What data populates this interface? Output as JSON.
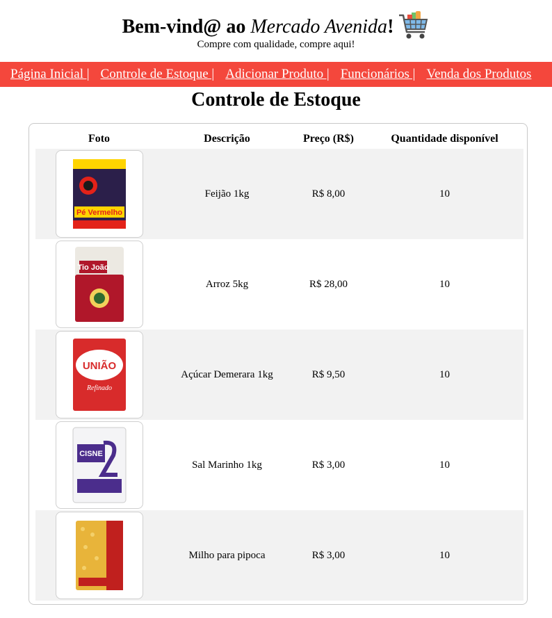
{
  "header": {
    "title_prefix": "Bem-vind@ ao ",
    "title_store": "Mercado Avenida",
    "title_suffix": "!",
    "subtitle": "Compre com qualidade, compre aqui!",
    "cart_icon": "shopping-cart-icon"
  },
  "nav": {
    "items": [
      {
        "label": "Página Inicial |"
      },
      {
        "label": "Controle de Estoque |"
      },
      {
        "label": "Adicionar Produto |"
      },
      {
        "label": "Funcionários |"
      },
      {
        "label": "Venda dos Produtos"
      }
    ],
    "background": "#f4473c"
  },
  "page_title": "Controle de Estoque",
  "table": {
    "headers": [
      "Foto",
      "Descrição",
      "Preço (R$)",
      "Quantidade disponível"
    ],
    "rows": [
      {
        "photo": "feijao-package",
        "description": "Feijão 1kg",
        "price": "R$ 8,00",
        "quantity": "10"
      },
      {
        "photo": "arroz-package",
        "description": "Arroz 5kg",
        "price": "R$ 28,00",
        "quantity": "10"
      },
      {
        "photo": "acucar-package",
        "description": "Açúcar Demerara 1kg",
        "price": "R$ 9,50",
        "quantity": "10"
      },
      {
        "photo": "sal-package",
        "description": "Sal Marinho 1kg",
        "price": "R$ 3,00",
        "quantity": "10"
      },
      {
        "photo": "milho-package",
        "description": "Milho para pipoca",
        "price": "R$ 3,00",
        "quantity": "10"
      }
    ]
  },
  "colors": {
    "nav_bg": "#f4473c",
    "row_stripe": "#f2f2f2"
  }
}
